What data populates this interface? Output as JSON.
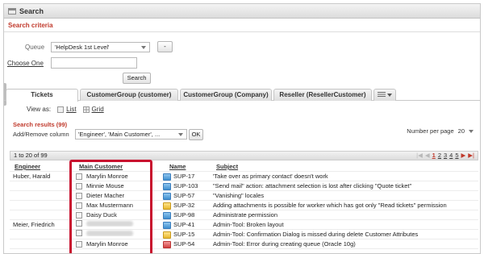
{
  "window": {
    "title": "Search"
  },
  "criteria": {
    "heading": "Search criteria",
    "queue_label": "Queue",
    "queue_value": "'HelpDesk 1st Level'",
    "minus_label": "-",
    "choose_one_label": "Choose One",
    "choose_one_value": "",
    "search_label": "Search"
  },
  "tabs": [
    {
      "label": "Tickets"
    },
    {
      "label": "CustomerGroup (customer)"
    },
    {
      "label": "CustomerGroup (Company)"
    },
    {
      "label": "Reseller (ResellerCustomer)"
    }
  ],
  "tab_menu_icon": "list-dropdown-icon",
  "view": {
    "label": "View as:",
    "list": "List",
    "grid": "Grid"
  },
  "results": {
    "heading": "Search results (99)",
    "addremove_label": "Add/Remove column",
    "columns_value": "'Engineer', 'Main Customer', ...",
    "ok_label": "OK",
    "npp_label": "Number per page",
    "npp_value": "20"
  },
  "pager": {
    "range": "1 to 20 of 99",
    "first": "|◀",
    "prev": "◀",
    "pages": [
      "1",
      "2",
      "3",
      "4",
      "5"
    ],
    "next": "▶",
    "last": "▶|"
  },
  "table": {
    "headers": {
      "engineer": "Engineer",
      "customer": "Main Customer",
      "name": "Name",
      "subject": "Subject"
    },
    "rows": [
      {
        "engineer": "Huber, Harald",
        "customer": "Marylin Monroe",
        "icon": "blue",
        "name": "SUP-17",
        "subject": "'Take over as primary contact' doesn't work"
      },
      {
        "engineer": "",
        "customer": "Minnie Mouse",
        "icon": "blue",
        "name": "SUP-103",
        "subject": "\"Send mail\" action: attachment selection is lost after clicking \"Quote ticket\""
      },
      {
        "engineer": "",
        "customer": "Dieter Macher",
        "icon": "blue",
        "name": "SUP-57",
        "subject": "\"Vanishing\" locales"
      },
      {
        "engineer": "",
        "customer": "Max Mustermann",
        "icon": "yellow",
        "name": "SUP-32",
        "subject": "Adding attachments is possible for worker which has got only \"Read tickets\" permission"
      },
      {
        "engineer": "",
        "customer": "Daisy Duck",
        "icon": "blue",
        "name": "SUP-98",
        "subject": "Administrate permission"
      },
      {
        "engineer": "Meier, Friedrich",
        "customer": "",
        "icon": "blue",
        "name": "SUP-41",
        "subject": "Admin-Tool: Broken layout"
      },
      {
        "engineer": "",
        "customer": "",
        "icon": "yellow",
        "name": "SUP-15",
        "subject": "Admin-Tool: Confirmation Dialog is missed during delete Customer Attributes"
      },
      {
        "engineer": "",
        "customer": "Marylin Monroe",
        "icon": "red",
        "name": "SUP-54",
        "subject": "Admin-Tool: Error during creating queue (Oracle 10g)"
      }
    ]
  }
}
